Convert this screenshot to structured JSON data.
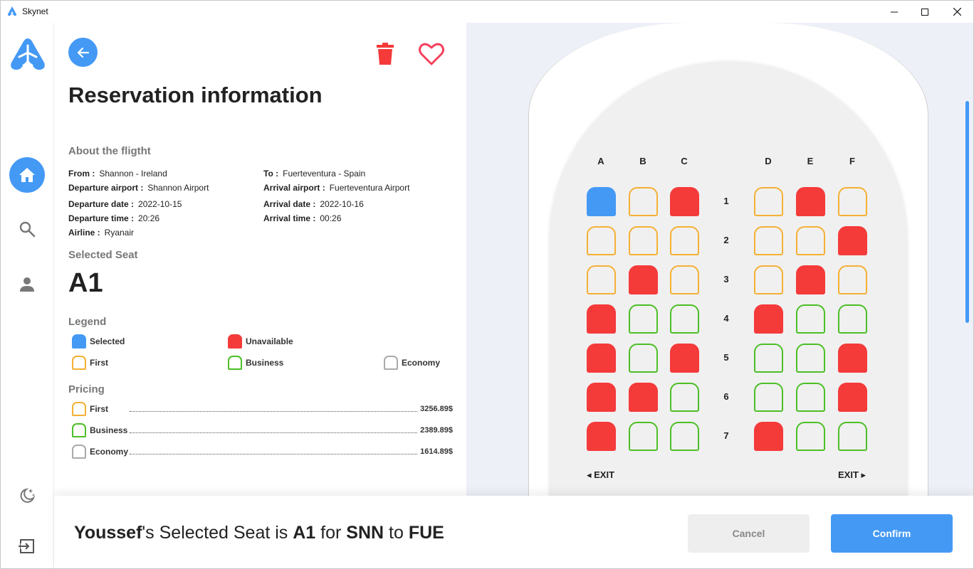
{
  "window": {
    "title": "Skynet"
  },
  "header": {
    "title": "Reservation information"
  },
  "flight": {
    "section_title": "About the fligtht",
    "from_label": "From :",
    "from_value": "Shannon - Ireland",
    "to_label": "To :",
    "to_value": "Fuerteventura - Spain",
    "dep_airport_label": "Departure airport :",
    "dep_airport_value": "Shannon Airport",
    "arr_airport_label": "Arrival airport :",
    "arr_airport_value": "Fuerteventura Airport",
    "dep_date_label": "Departure date :",
    "dep_date_value": "2022-10-15",
    "arr_date_label": "Arrival date :",
    "arr_date_value": "2022-10-16",
    "dep_time_label": "Departure time :",
    "dep_time_value": "20:26",
    "arr_time_label": "Arrival time :",
    "arr_time_value": "00:26",
    "airline_label": "Airline :",
    "airline_value": "Ryanair"
  },
  "selected_seat": {
    "title": "Selected Seat",
    "value": "A1"
  },
  "legend": {
    "title": "Legend",
    "selected": "Selected",
    "unavailable": "Unavailable",
    "first": "First",
    "business": "Business",
    "economy": "Economy"
  },
  "pricing": {
    "title": "Pricing",
    "items": [
      {
        "class": "first",
        "label": "First",
        "price": "3256.89$"
      },
      {
        "class": "bus",
        "label": "Business",
        "price": "2389.89$"
      },
      {
        "class": "eco",
        "label": "Economy",
        "price": "1614.89$"
      }
    ]
  },
  "seat_map": {
    "columns": [
      "A",
      "B",
      "C",
      "D",
      "E",
      "F"
    ],
    "rows": [
      {
        "number": "1",
        "seats": [
          "selected",
          "first",
          "unavailable",
          "first",
          "unavailable",
          "first"
        ]
      },
      {
        "number": "2",
        "seats": [
          "first",
          "first",
          "first",
          "first",
          "first",
          "unavailable"
        ]
      },
      {
        "number": "3",
        "seats": [
          "first",
          "unavailable",
          "first",
          "first",
          "unavailable",
          "first"
        ]
      },
      {
        "number": "4",
        "seats": [
          "unavailable",
          "business",
          "business",
          "unavailable",
          "business",
          "business"
        ]
      },
      {
        "number": "5",
        "seats": [
          "unavailable",
          "business",
          "unavailable",
          "business",
          "business",
          "unavailable"
        ]
      },
      {
        "number": "6",
        "seats": [
          "unavailable",
          "unavailable",
          "business",
          "business",
          "business",
          "unavailable"
        ]
      },
      {
        "number": "7",
        "seats": [
          "unavailable",
          "business",
          "business",
          "unavailable",
          "business",
          "business"
        ]
      }
    ],
    "exit_left": "◂ EXIT",
    "exit_right": "EXIT ▸"
  },
  "summary": {
    "user": "Youssef",
    "middle": "'s Selected Seat is ",
    "seat": "A1",
    "for": " for ",
    "origin": "SNN",
    "to": " to ",
    "destination": "FUE"
  },
  "buttons": {
    "cancel": "Cancel",
    "confirm": "Confirm"
  },
  "colors": {
    "accent": "#4499f5",
    "unavailable": "#f53a3a",
    "first": "#f5b035",
    "business": "#4cbf26",
    "economy": "#aaaaaa"
  },
  "icons": [
    "plane-logo-icon",
    "back-arrow-icon",
    "trash-icon",
    "heart-icon",
    "home-icon",
    "search-icon",
    "user-icon",
    "moon-icon",
    "logout-icon",
    "minimize-icon",
    "maximize-icon",
    "close-icon"
  ]
}
